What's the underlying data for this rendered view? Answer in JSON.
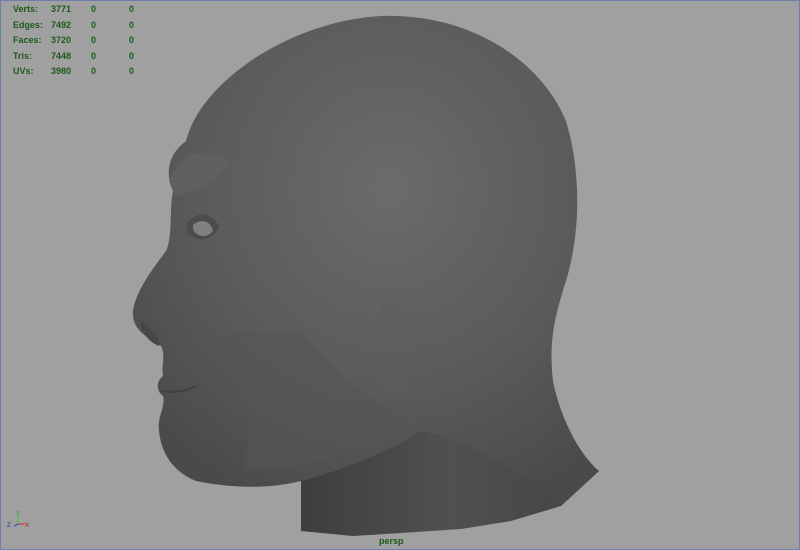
{
  "hud": {
    "rows": [
      {
        "label": "Verts:",
        "v1": "3771",
        "v2": "0",
        "v3": "0"
      },
      {
        "label": "Edges:",
        "v1": "7492",
        "v2": "0",
        "v3": "0"
      },
      {
        "label": "Faces:",
        "v1": "3720",
        "v2": "0",
        "v3": "0"
      },
      {
        "label": "Tris:",
        "v1": "7448",
        "v2": "0",
        "v3": "0"
      },
      {
        "label": "UVs:",
        "v1": "3980",
        "v2": "0",
        "v3": "0"
      }
    ]
  },
  "axis": {
    "y": "Y",
    "z": "Z",
    "x": "X"
  },
  "camera": {
    "name": "persp"
  },
  "colors": {
    "background": "#a0a0a0",
    "hud_text": "#1c5a1c",
    "model": "#5a5a5a"
  }
}
